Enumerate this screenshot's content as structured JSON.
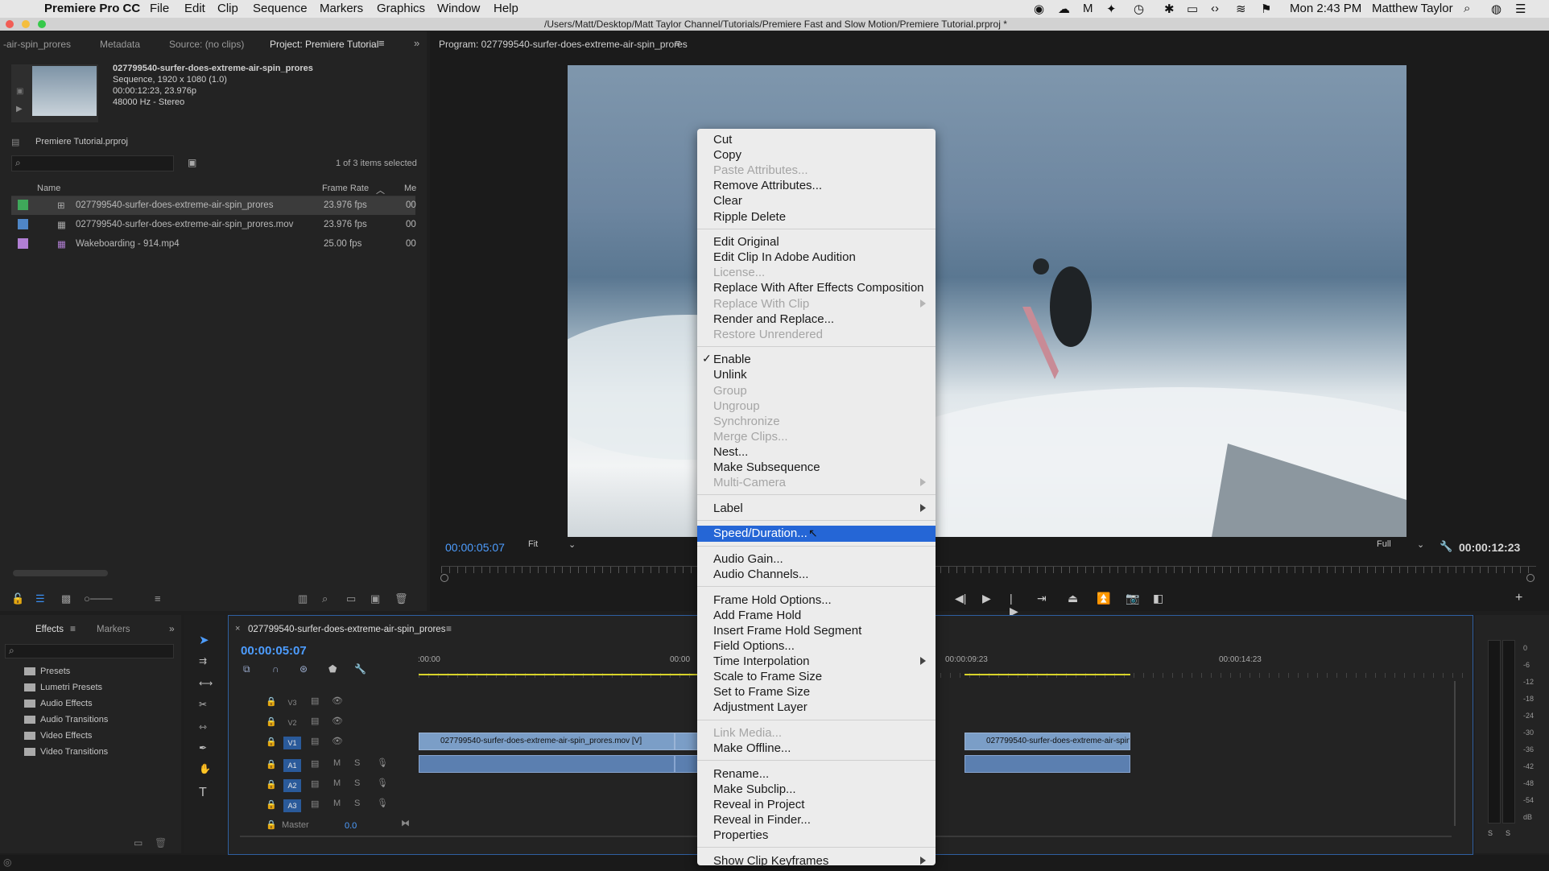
{
  "menubar": {
    "app": "Premiere Pro CC",
    "items": [
      "File",
      "Edit",
      "Clip",
      "Sequence",
      "Markers",
      "Graphics",
      "Window",
      "Help"
    ],
    "clock": "Mon 2:43 PM",
    "user": "Matthew Taylor"
  },
  "titlebar": {
    "path": "/Users/Matt/Desktop/Matt Taylor Channel/Tutorials/Premiere Fast and Slow Motion/Premiere Tutorial.prproj *"
  },
  "project_panel": {
    "tabs": [
      "-air-spin_prores",
      "Metadata",
      "Source: (no clips)",
      "Project: Premiere Tutorial"
    ],
    "clip_info": {
      "name": "027799540-surfer-does-extreme-air-spin_prores",
      "line1": "Sequence, 1920 x 1080 (1.0)",
      "line2": "00:00:12:23, 23.976p",
      "line3": "48000 Hz - Stereo"
    },
    "project_file": "Premiere Tutorial.prproj",
    "selection": "1 of 3 items selected",
    "columns": [
      "Name",
      "Frame Rate",
      "Me"
    ],
    "items": [
      {
        "name": "027799540-surfer-does-extreme-air-spin_prores",
        "rate": "23.976 fps",
        "me": "00",
        "color": "#3fa85a"
      },
      {
        "name": "027799540-surfer-does-extreme-air-spin_prores.mov",
        "rate": "23.976 fps",
        "me": "00",
        "color": "#4f86c6"
      },
      {
        "name": "Wakeboarding - 914.mp4",
        "rate": "25.00 fps",
        "me": "00",
        "color": "#b17fd4"
      }
    ]
  },
  "program_monitor": {
    "title": "Program: 027799540-surfer-does-extreme-air-spin_prores",
    "timecode": "00:00:05:07",
    "fit": "Fit",
    "quality": "Full",
    "duration": "00:00:12:23"
  },
  "effects_panel": {
    "tabs": [
      "Effects",
      "Markers"
    ],
    "folders": [
      "Presets",
      "Lumetri Presets",
      "Audio Effects",
      "Audio Transitions",
      "Video Effects",
      "Video Transitions"
    ]
  },
  "timeline": {
    "tab": "027799540-surfer-does-extreme-air-spin_prores",
    "timecode": "00:00:05:07",
    "ruler": [
      ":00:00",
      "00:00",
      "00:00:09:23",
      "00:00:14:23"
    ],
    "video_tracks": [
      "V3",
      "V2",
      "V1"
    ],
    "audio_tracks": [
      "A1",
      "A2",
      "A3"
    ],
    "master": "Master",
    "master_value": "0.0",
    "clip_v1_left": "027799540-surfer-does-extreme-air-spin_prores.mov [V]",
    "clip_v1_right": "027799540-surfer-does-extreme-air-spin_",
    "m_label": "M",
    "s_label": "S"
  },
  "meter": {
    "labels": [
      "0",
      "-6",
      "-12",
      "-18",
      "-24",
      "-30",
      "-36",
      "-42",
      "-48",
      "-54",
      "dB"
    ],
    "s": "S"
  },
  "context_menu": {
    "groups": [
      [
        {
          "t": "Cut"
        },
        {
          "t": "Copy"
        },
        {
          "t": "Paste Attributes...",
          "dis": true
        },
        {
          "t": "Remove Attributes..."
        },
        {
          "t": "Clear"
        },
        {
          "t": "Ripple Delete"
        }
      ],
      [
        {
          "t": "Edit Original"
        },
        {
          "t": "Edit Clip In Adobe Audition"
        },
        {
          "t": "License...",
          "dis": true
        },
        {
          "t": "Replace With After Effects Composition"
        },
        {
          "t": "Replace With Clip",
          "dis": true,
          "sub": true
        },
        {
          "t": "Render and Replace..."
        },
        {
          "t": "Restore Unrendered",
          "dis": true
        }
      ],
      [
        {
          "t": "Enable",
          "check": true
        },
        {
          "t": "Unlink"
        },
        {
          "t": "Group",
          "dis": true
        },
        {
          "t": "Ungroup",
          "dis": true
        },
        {
          "t": "Synchronize",
          "dis": true
        },
        {
          "t": "Merge Clips...",
          "dis": true
        },
        {
          "t": "Nest..."
        },
        {
          "t": "Make Subsequence"
        },
        {
          "t": "Multi-Camera",
          "dis": true,
          "sub": true
        }
      ],
      [
        {
          "t": "Label",
          "sub": true
        }
      ],
      [
        {
          "t": "Speed/Duration...",
          "hl": true
        }
      ],
      [
        {
          "t": "Audio Gain..."
        },
        {
          "t": "Audio Channels..."
        }
      ],
      [
        {
          "t": "Frame Hold Options..."
        },
        {
          "t": "Add Frame Hold"
        },
        {
          "t": "Insert Frame Hold Segment"
        },
        {
          "t": "Field Options..."
        },
        {
          "t": "Time Interpolation",
          "sub": true
        },
        {
          "t": "Scale to Frame Size"
        },
        {
          "t": "Set to Frame Size"
        },
        {
          "t": "Adjustment Layer"
        }
      ],
      [
        {
          "t": "Link Media...",
          "dis": true
        },
        {
          "t": "Make Offline..."
        }
      ],
      [
        {
          "t": "Rename..."
        },
        {
          "t": "Make Subclip..."
        },
        {
          "t": "Reveal in Project"
        },
        {
          "t": "Reveal in Finder..."
        },
        {
          "t": "Properties"
        }
      ],
      [
        {
          "t": "Show Clip Keyframes",
          "sub": true
        }
      ]
    ]
  }
}
